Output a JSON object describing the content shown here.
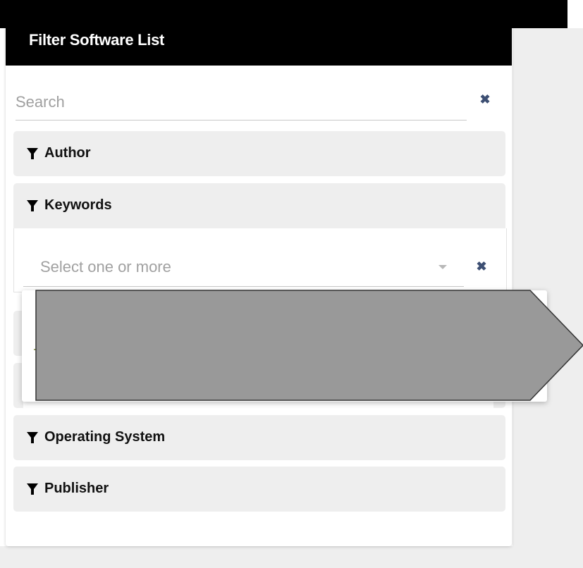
{
  "panel": {
    "title": "Filter Software List"
  },
  "search": {
    "placeholder": "Search",
    "value": "",
    "clear_glyph": "✖"
  },
  "facets": [
    {
      "label": "Author",
      "expanded": false,
      "icon": "funnel-icon"
    },
    {
      "label": "Keywords",
      "expanded": true,
      "icon": "funnel-icon"
    },
    {
      "label": "Operating System",
      "expanded": false,
      "icon": "funnel-icon"
    },
    {
      "label": "Publisher",
      "expanded": false,
      "icon": "funnel-icon"
    }
  ],
  "keywords_select": {
    "placeholder": "Select one or more",
    "clear_glyph": "✖"
  },
  "colors": {
    "header_bg": "#000000",
    "facet_bg": "#eeeeee",
    "clear_icon": "#3d4f73",
    "redaction_fill": "#999999"
  }
}
